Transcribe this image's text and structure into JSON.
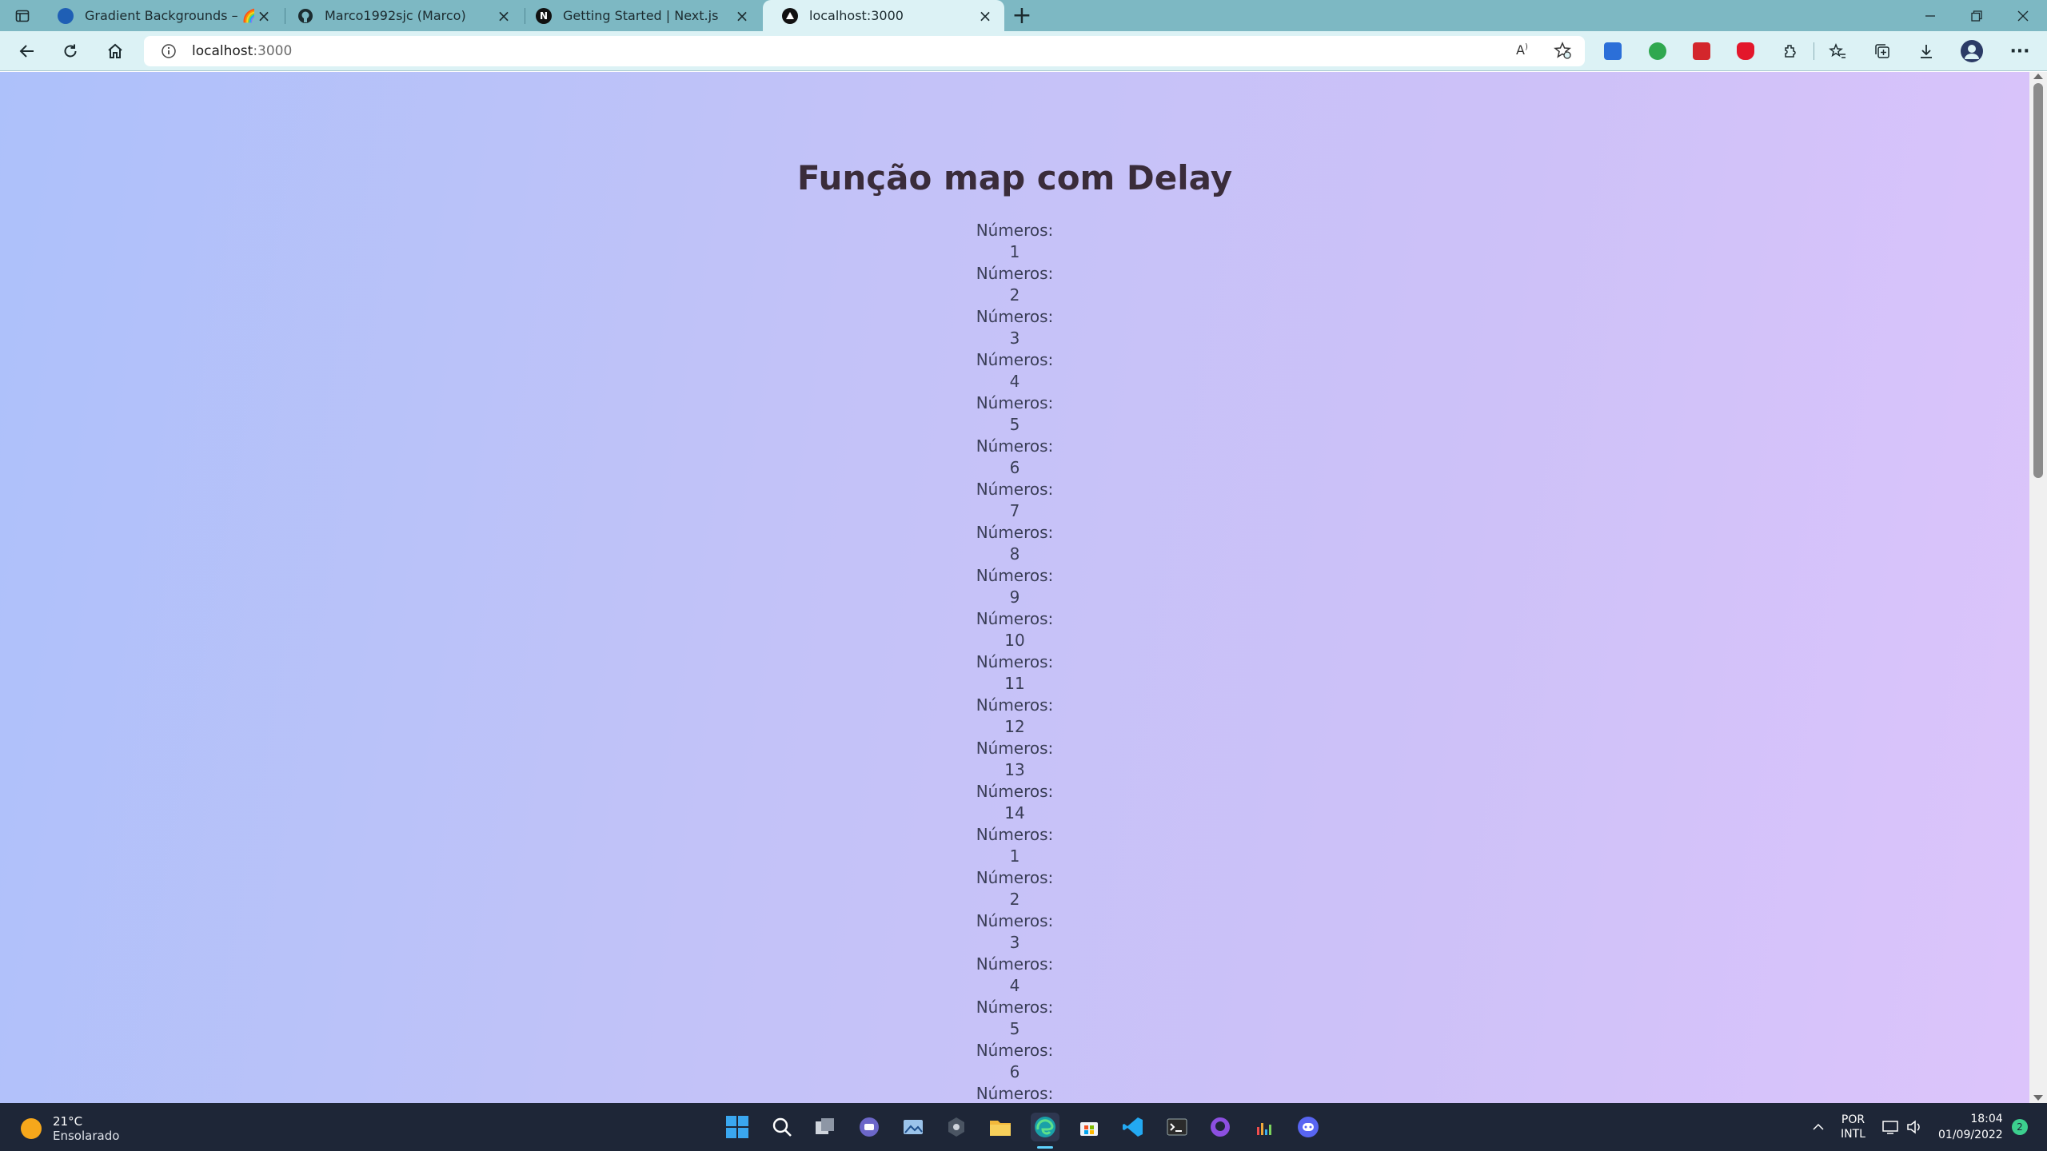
{
  "browser": {
    "tabs": [
      {
        "title": "Gradient Backgrounds – 🌈 The",
        "favicon": "edge-blue-circle-icon"
      },
      {
        "title": "Marco1992sjc (Marco)",
        "favicon": "github-icon"
      },
      {
        "title": "Getting Started | Next.js",
        "favicon": "nextjs-icon"
      },
      {
        "title": "localhost:3000",
        "favicon": "vercel-triangle-icon"
      }
    ],
    "address": {
      "host": "localhost",
      "port": ":3000"
    }
  },
  "page": {
    "title": "Função map com Delay",
    "item_label": "Números:",
    "items": [
      {
        "label": "Números:",
        "value": "1"
      },
      {
        "label": "Números:",
        "value": "2"
      },
      {
        "label": "Números:",
        "value": "3"
      },
      {
        "label": "Números:",
        "value": "4"
      },
      {
        "label": "Números:",
        "value": "5"
      },
      {
        "label": "Números:",
        "value": "6"
      },
      {
        "label": "Números:",
        "value": "7"
      },
      {
        "label": "Números:",
        "value": "8"
      },
      {
        "label": "Números:",
        "value": "9"
      },
      {
        "label": "Números:",
        "value": "10"
      },
      {
        "label": "Números:",
        "value": "11"
      },
      {
        "label": "Números:",
        "value": "12"
      },
      {
        "label": "Números:",
        "value": "13"
      },
      {
        "label": "Números:",
        "value": "14"
      },
      {
        "label": "Números:",
        "value": "1"
      },
      {
        "label": "Números:",
        "value": "2"
      },
      {
        "label": "Números:",
        "value": "3"
      },
      {
        "label": "Números:",
        "value": "4"
      },
      {
        "label": "Números:",
        "value": "5"
      },
      {
        "label": "Números:",
        "value": "6"
      },
      {
        "label": "Números:",
        "value": ""
      }
    ]
  },
  "taskbar": {
    "weather": {
      "temp": "21°C",
      "condition": "Ensolarado"
    },
    "lang": {
      "line1": "POR",
      "line2": "INTL"
    },
    "clock": {
      "time": "18:04",
      "date": "01/09/2022"
    },
    "notifications": "2"
  },
  "colors": {
    "tabstrip": "#7db8c3",
    "toolbar": "#dcf2f5",
    "gradient_start": "#adc1fa",
    "gradient_end": "#dcc4fb",
    "taskbar": "#1e2637"
  }
}
